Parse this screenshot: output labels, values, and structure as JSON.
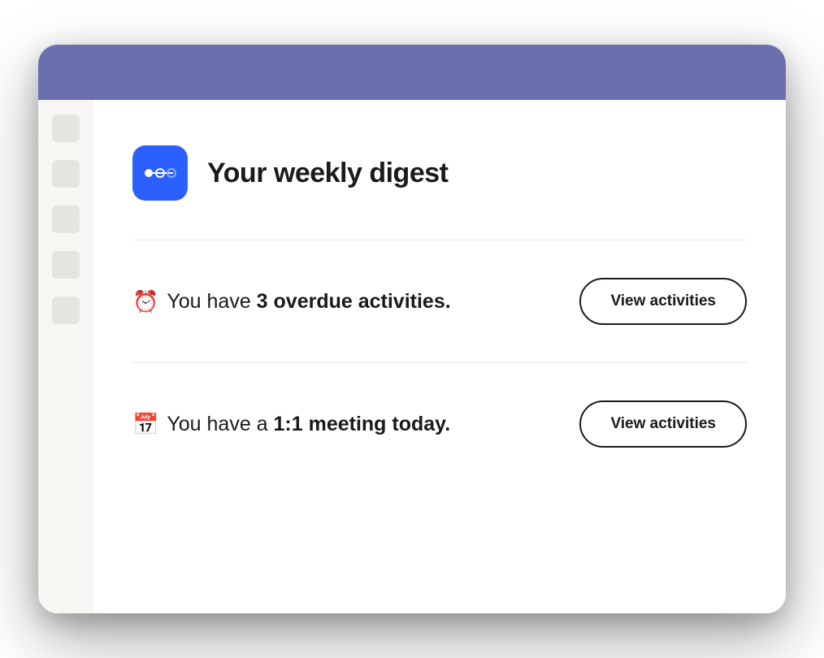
{
  "header": {
    "title": "Your weekly digest",
    "app_icon_name": "dommo-logo-icon"
  },
  "digest": {
    "items": [
      {
        "emoji": "⏰",
        "text_prefix": "You have ",
        "text_bold": "3 overdue activities.",
        "button_label": "View activities"
      },
      {
        "emoji": "📅",
        "text_prefix": "You have a ",
        "text_bold": "1:1 meeting today.",
        "button_label": "View activities"
      }
    ]
  }
}
